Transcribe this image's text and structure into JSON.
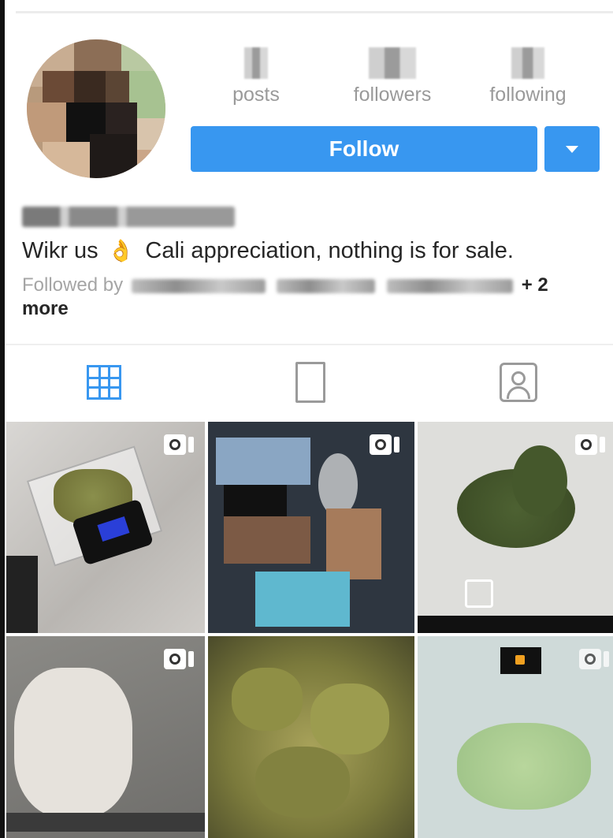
{
  "profile": {
    "stats": [
      {
        "label": "posts"
      },
      {
        "label": "followers"
      },
      {
        "label": "following"
      }
    ],
    "follow_label": "Follow",
    "bio_prefix": "Wikr us",
    "bio_emoji": "👌",
    "bio_suffix": "Cali appreciation, nothing is for sale.",
    "followed_by_prefix": "Followed by",
    "followed_by_more_count": "+ 2",
    "followed_by_more_word": "more"
  },
  "tabs": [
    {
      "icon": "grid-icon",
      "active": true
    },
    {
      "icon": "feed-icon",
      "active": false
    },
    {
      "icon": "tagged-icon",
      "active": false
    }
  ],
  "posts": [
    {
      "kind": "video",
      "subject": "scale"
    },
    {
      "kind": "video",
      "subject": "person"
    },
    {
      "kind": "video",
      "subject": "plant"
    },
    {
      "kind": "video",
      "subject": "hand"
    },
    {
      "kind": "photo",
      "subject": "buds"
    },
    {
      "kind": "video",
      "subject": "crystals"
    }
  ],
  "colors": {
    "accent": "#3897f0",
    "muted_text": "#9a9a9a",
    "body_text": "#262626"
  }
}
